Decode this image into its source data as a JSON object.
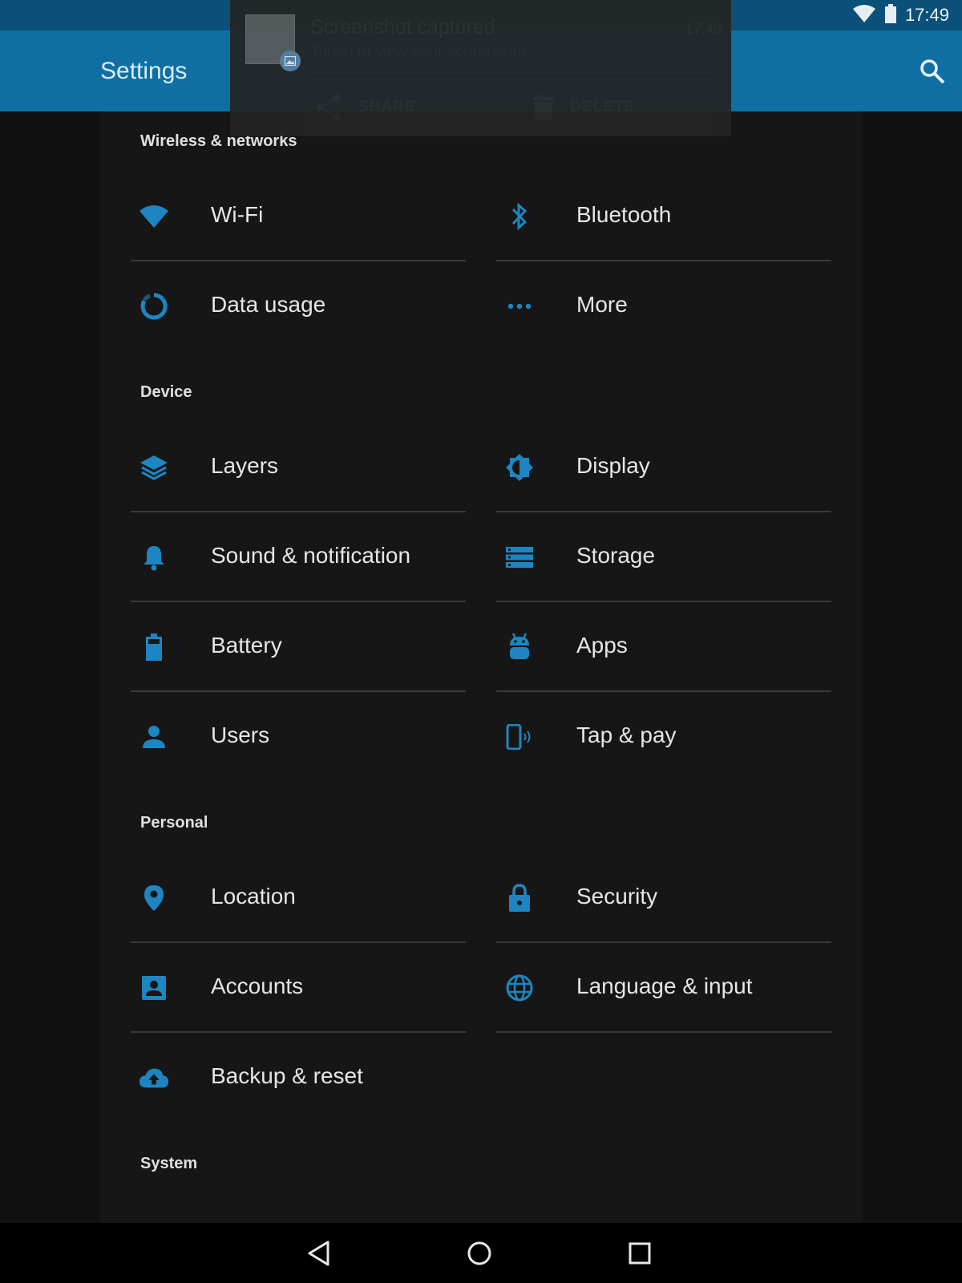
{
  "status_bar": {
    "time": "17:49"
  },
  "action_bar": {
    "title": "Settings"
  },
  "notification": {
    "title": "Screenshot captured.",
    "subtitle": "Touch to view your screenshot.",
    "time": "17:49",
    "share_label": "SHARE",
    "delete_label": "DELETE"
  },
  "sections": {
    "wireless": {
      "header": "Wireless & networks",
      "items": {
        "wifi": "Wi-Fi",
        "bluetooth": "Bluetooth",
        "data_usage": "Data usage",
        "more": "More"
      }
    },
    "device": {
      "header": "Device",
      "items": {
        "layers": "Layers",
        "display": "Display",
        "sound": "Sound & notification",
        "storage": "Storage",
        "battery": "Battery",
        "apps": "Apps",
        "users": "Users",
        "tap_pay": "Tap & pay"
      }
    },
    "personal": {
      "header": "Personal",
      "items": {
        "location": "Location",
        "security": "Security",
        "accounts": "Accounts",
        "language": "Language & input",
        "backup": "Backup & reset"
      }
    },
    "system": {
      "header": "System"
    }
  },
  "colors": {
    "accent": "#1d86c2",
    "action_bar": "#0f6fa3",
    "status_bar": "#0a5078",
    "background": "#111111"
  }
}
